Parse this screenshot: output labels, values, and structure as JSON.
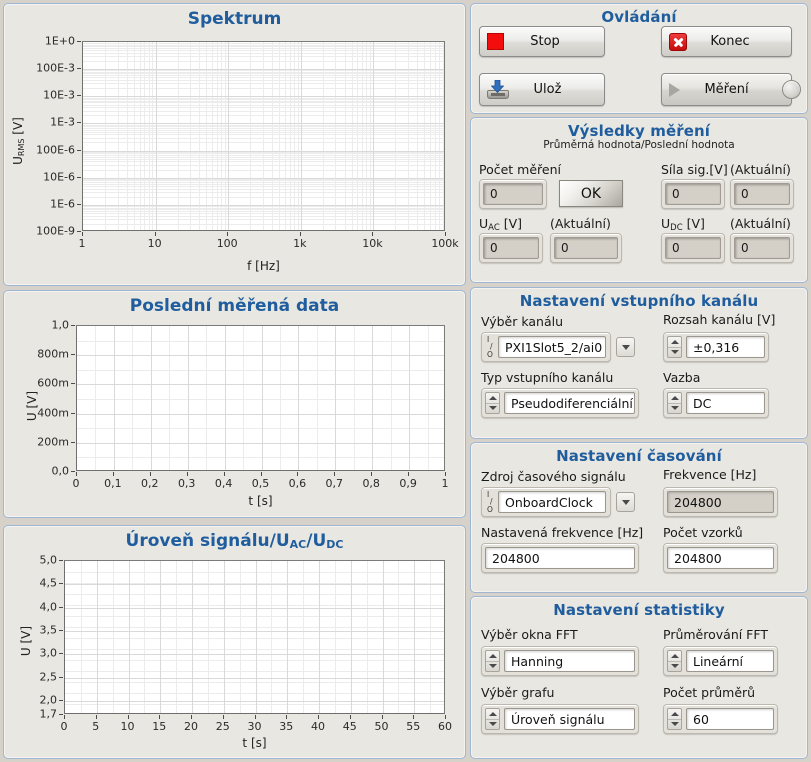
{
  "charts": {
    "spectrum": {
      "title": "Spektrum",
      "ylabel_main": "U",
      "ylabel_sub": "RMS",
      "ylabel_unit": " [V]",
      "xlabel": "f [Hz]",
      "ytick_labels": [
        "1E+0",
        "100E-3",
        "10E-3",
        "1E-3",
        "100E-6",
        "10E-6",
        "1E-6",
        "100E-9"
      ],
      "xtick_labels": [
        "1",
        "10",
        "100",
        "1k",
        "10k",
        "100k"
      ]
    },
    "lastdata": {
      "title": "Poslední měřená data",
      "ylabel": "U [V]",
      "xlabel": "t [s]",
      "ytick_labels": [
        "1,0",
        "800m",
        "600m",
        "400m",
        "200m",
        "0,0"
      ],
      "xtick_labels": [
        "0",
        "0,1",
        "0,2",
        "0,3",
        "0,4",
        "0,5",
        "0,6",
        "0,7",
        "0,8",
        "0,9",
        "1"
      ]
    },
    "level": {
      "title_main": "Úroveň signálu/U",
      "title_sub1": "AC",
      "title_mid": "/U",
      "title_sub2": "DC",
      "ylabel": "U [V]",
      "xlabel": "t [s]",
      "ytick_labels": [
        "5,0",
        "4,5",
        "4,0",
        "3,5",
        "3,0",
        "2,5",
        "2,0",
        "1,7"
      ],
      "xtick_labels": [
        "0",
        "5",
        "10",
        "15",
        "20",
        "25",
        "30",
        "35",
        "40",
        "45",
        "50",
        "55",
        "60"
      ]
    }
  },
  "chart_data": [
    {
      "type": "line",
      "title": "Spektrum",
      "xlabel": "f [Hz]",
      "ylabel": "URMS [V]",
      "xscale": "log",
      "yscale": "log",
      "xlim": [
        1,
        100000
      ],
      "ylim": [
        1e-07,
        1
      ],
      "xticks": [
        1,
        10,
        100,
        1000,
        10000,
        100000
      ],
      "xtick_labels": [
        "1",
        "10",
        "100",
        "1k",
        "10k",
        "100k"
      ],
      "yticks": [
        1,
        0.1,
        0.01,
        0.001,
        0.0001,
        1e-05,
        1e-06,
        1e-07
      ],
      "ytick_labels": [
        "1E+0",
        "100E-3",
        "10E-3",
        "1E-3",
        "100E-6",
        "10E-6",
        "1E-6",
        "100E-9"
      ],
      "grid": true,
      "legend": false,
      "series": [
        {
          "name": "URMS",
          "x": [],
          "y": []
        }
      ]
    },
    {
      "type": "line",
      "title": "Poslední měřená data",
      "xlabel": "t [s]",
      "ylabel": "U [V]",
      "xlim": [
        0,
        1
      ],
      "ylim": [
        0,
        1
      ],
      "xticks": [
        0,
        0.1,
        0.2,
        0.3,
        0.4,
        0.5,
        0.6,
        0.7,
        0.8,
        0.9,
        1
      ],
      "xtick_labels": [
        "0",
        "0,1",
        "0,2",
        "0,3",
        "0,4",
        "0,5",
        "0,6",
        "0,7",
        "0,8",
        "0,9",
        "1"
      ],
      "yticks": [
        0,
        0.2,
        0.4,
        0.6,
        0.8,
        1.0
      ],
      "ytick_labels": [
        "0,0",
        "200m",
        "400m",
        "600m",
        "800m",
        "1,0"
      ],
      "grid": true,
      "legend": false,
      "series": [
        {
          "name": "U",
          "x": [],
          "y": []
        }
      ]
    },
    {
      "type": "line",
      "title": "Úroveň signálu/UAC/UDC",
      "xlabel": "t [s]",
      "ylabel": "U [V]",
      "xlim": [
        0,
        60
      ],
      "ylim": [
        1.7,
        5.0
      ],
      "xticks": [
        0,
        5,
        10,
        15,
        20,
        25,
        30,
        35,
        40,
        45,
        50,
        55,
        60
      ],
      "xtick_labels": [
        "0",
        "5",
        "10",
        "15",
        "20",
        "25",
        "30",
        "35",
        "40",
        "45",
        "50",
        "55",
        "60"
      ],
      "yticks": [
        1.7,
        2.0,
        2.5,
        3.0,
        3.5,
        4.0,
        4.5,
        5.0
      ],
      "ytick_labels": [
        "1,7",
        "2,0",
        "2,5",
        "3,0",
        "3,5",
        "4,0",
        "4,5",
        "5,0"
      ],
      "grid": true,
      "legend": false,
      "series": [
        {
          "name": "U",
          "x": [],
          "y": []
        }
      ]
    }
  ],
  "control_panel": {
    "title": "Ovládání",
    "stop_label": "Stop",
    "konec_label": "Konec",
    "uloz_label": "Ulož",
    "mereni_label": "Měření"
  },
  "results": {
    "title": "Výsledky měření",
    "subtitle": "Průměrná hodnota/Poslední hodnota",
    "count_label": "Počet měření",
    "count_value": "0",
    "ok_label": "OK",
    "sila_label": "Síla sig.[V]",
    "sila_aktualni_label": "(Aktuální)",
    "sila_value": "0",
    "sila_aktualni_value": "0",
    "uac_label_main": "U",
    "uac_label_sub": "AC",
    "uac_label_unit": " [V]",
    "uac_aktualni_label": "(Aktuální)",
    "uac_value": "0",
    "uac_aktualni_value": "0",
    "udc_label_main": "U",
    "udc_label_sub": "DC",
    "udc_label_unit": " [V]",
    "udc_aktualni_label": "(Aktuální)",
    "udc_value": "0",
    "udc_aktualni_value": "0"
  },
  "channel_settings": {
    "title": "Nastavení vstupního kanálu",
    "channel_label": "Výběr kanálu",
    "channel_value": "PXI1Slot5_2/ai0",
    "range_label": "Rozsah kanálu [V]",
    "range_value": "±0,316",
    "type_label": "Typ vstupního kanálu",
    "type_value": "Pseudodiferenciální",
    "coupling_label": "Vazba",
    "coupling_value": "DC"
  },
  "timing_settings": {
    "title": "Nastavení časování",
    "clock_label": "Zdroj časového signálu",
    "clock_value": "OnboardClock",
    "freq_label": "Frekvence [Hz]",
    "freq_value": "204800",
    "setfreq_label": "Nastavená frekvence [Hz]",
    "setfreq_value": "204800",
    "samples_label": "Počet vzorků",
    "samples_value": "204800"
  },
  "stat_settings": {
    "title": "Nastavení statistiky",
    "window_label": "Výběr okna FFT",
    "window_value": "Hanning",
    "avg_label": "Průměrování FFT",
    "avg_value": "Lineární",
    "graph_label": "Výběr grafu",
    "graph_value": "Úroveň signálu",
    "navg_label": "Počet průměrů",
    "navg_value": "60"
  },
  "colors": {
    "accent": "#1f5d9e",
    "panel_bg": "#e9e7e1",
    "panel_border": "#9fb6d4",
    "stop_red": "#f30d0d",
    "window_bg": "#d6d2ca"
  }
}
